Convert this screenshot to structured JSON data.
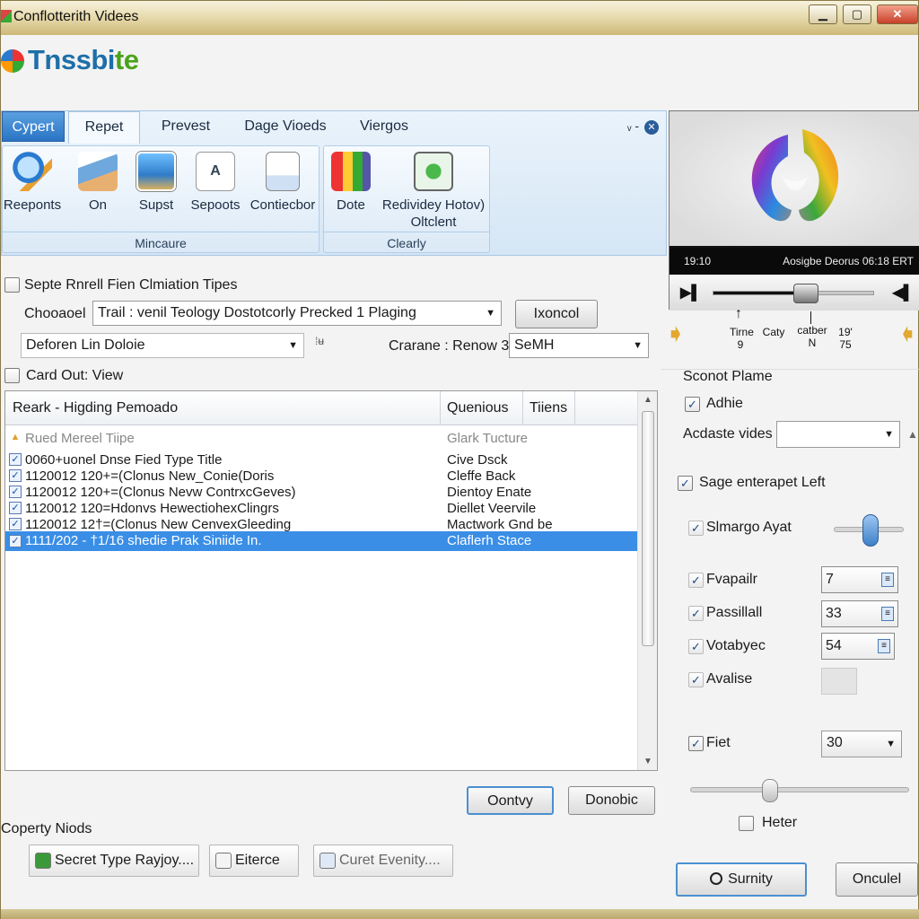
{
  "window": {
    "title": "Conflotterith Videes",
    "minimize": "▁",
    "maximize": "▢",
    "close": "✕"
  },
  "app": {
    "logo_main": "Tnssbi",
    "logo_accent": "te"
  },
  "ribbon": {
    "tabs": [
      {
        "label": "Cypert"
      },
      {
        "label": "Repet"
      },
      {
        "label": "Prevest"
      },
      {
        "label": "Dage Vioeds"
      },
      {
        "label": "Viergos"
      }
    ],
    "tab_controls": "ᵥ -",
    "group1": {
      "name": "Mincaure",
      "buttons": [
        {
          "label": "Reeponts",
          "icon": "magnifier-icon"
        },
        {
          "label": "On",
          "icon": "hand-card-icon"
        },
        {
          "label": "Supst",
          "icon": "gallery-icon"
        },
        {
          "label": "Sepoots",
          "icon": "document-a-icon"
        },
        {
          "label": "Contiecbor",
          "icon": "document-icon"
        }
      ]
    },
    "group2": {
      "name": "Clearly",
      "buttons": [
        {
          "label": "Dote",
          "icon": "paint-bucket-icon"
        },
        {
          "label": "Redividey Hotov)",
          "label2": "Oltclent",
          "icon": "refresh-monitor-icon"
        }
      ]
    }
  },
  "form": {
    "option1_label": "Septe Rnrell Fien Clmiation Tipes",
    "option1_checked": false,
    "choose_label": "Chooaoel",
    "choose_value": "Trail : venil Teology Dostotcorly Precked 1 Plaging",
    "cancel_button": "Ixoncol",
    "deforen_label": "Deforen Lin Doloie",
    "mini_icon": "⁞ʉ",
    "carane_label": "Crarane : Renow 3",
    "carane_value": "SeMH",
    "card_out_label": "Card Out: View",
    "card_out_checked": false
  },
  "list": {
    "columns": [
      "Reark - Higding Pemoado",
      "Quenious",
      "Tiiens"
    ],
    "rows": [
      {
        "c1": "Rued Mereel Tiipe",
        "c2": "Glark Tucture",
        "kind": "group"
      },
      {
        "c1": "0060+uonel Dnse Fied Type Title",
        "c2": "Cive Dsck",
        "kind": "item"
      },
      {
        "c1": "1120012 120+=(Clonus New_Conie(Doris",
        "c2": "Cleffe Back",
        "kind": "item"
      },
      {
        "c1": "1120012 120+=(Clonus Nevw ContrxcGeves)",
        "c2": "Dientoy Enate",
        "kind": "item"
      },
      {
        "c1": "1120012 120=Hdonvs HewectiohexClingrs",
        "c2": "Diellet Veervile",
        "kind": "item"
      },
      {
        "c1": "1120012 12†=(Clonus New CenvexGleeding",
        "c2": "Mactwork Gnd be",
        "kind": "item"
      },
      {
        "c1": "1111/202 - †1/16 shedie Prak Siniide In.",
        "c2": "Claflerh Stace",
        "kind": "selected"
      }
    ]
  },
  "actions": {
    "ok_button": "Oontvy",
    "second_button": "Donobic"
  },
  "copy_nods": {
    "label": "Coperty Niods",
    "buttons": [
      "Secret Type Rayjoy....",
      "Eiterce",
      "Curet Evenity...."
    ]
  },
  "player": {
    "status_left": "19:10",
    "status_right": "Aosigbe Deorus 06:18 ERT",
    "progress": 0.58,
    "annotations": [
      {
        "top": "Tirne",
        "bottom": "9"
      },
      {
        "top": "Caty",
        "bottom": ""
      },
      {
        "top": "catber",
        "bottom": "N"
      },
      {
        "top": "19'",
        "bottom": "75"
      }
    ]
  },
  "panel": {
    "section_title": "Sconot Plame",
    "adhie_label": "Adhie",
    "adhie_checked": true,
    "acdaste_label": "Acdaste vides",
    "acdaste_value": "",
    "sage_label": "Sage enterapet Left",
    "sage_checked": true,
    "slmargo_label": "Slmargo Ayat",
    "fvapailr_label": "Fvapailr",
    "fvapailr_value": "7",
    "passillall_label": "Passillall",
    "passillall_value": "33",
    "votabyec_label": "Votabyec",
    "votabyec_value": "54",
    "avalise_label": "Avalise",
    "fiet_label": "Fiet",
    "fiet_checked": true,
    "fiet_value": "30",
    "slider_value": 0.36,
    "heter_label": "Heter",
    "heter_checked": false,
    "summary_button": "Surnity",
    "cancel_button": "Onculel"
  },
  "colors": {
    "accent_blue": "#3a8ee6",
    "title_gold": "#cdb878",
    "logo_blue": "#1d6fa8",
    "logo_green": "#4aa31c"
  }
}
